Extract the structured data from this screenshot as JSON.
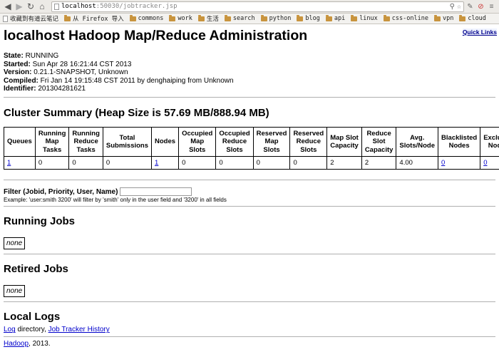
{
  "browser": {
    "url_host": "localhost",
    "url_rest": ":50030/jobtracker.jsp",
    "bookmarks": [
      "收藏到有道云笔记",
      "从 Firefox 导入",
      "commons",
      "work",
      "生活",
      "search",
      "python",
      "blog",
      "api",
      "linux",
      "css-online",
      "vpn",
      "cloud"
    ]
  },
  "page": {
    "quick_links": "Quick Links",
    "title": "localhost Hadoop Map/Reduce Administration",
    "info": {
      "state_label": "State:",
      "state": "RUNNING",
      "started_label": "Started:",
      "started": "Sun Apr 28 16:21:44 CST 2013",
      "version_label": "Version:",
      "version": "0.21.1-SNAPSHOT, Unknown",
      "compiled_label": "Compiled:",
      "compiled": "Fri Jan 14 19:15:48 CST 2011 by denghaiping from Unknown",
      "identifier_label": "Identifier:",
      "identifier": "201304281621"
    },
    "cluster": {
      "title": "Cluster Summary (Heap Size is 57.69 MB/888.94 MB)",
      "headers": [
        "Queues",
        "Running Map Tasks",
        "Running Reduce Tasks",
        "Total Submissions",
        "Nodes",
        "Occupied Map Slots",
        "Occupied Reduce Slots",
        "Reserved Map Slots",
        "Reserved Reduce Slots",
        "Map Slot Capacity",
        "Reduce Slot Capacity",
        "Avg. Slots/Node",
        "Blacklisted Nodes",
        "Excluded Nodes"
      ],
      "values": [
        "1",
        "0",
        "0",
        "0",
        "1",
        "0",
        "0",
        "0",
        "0",
        "2",
        "2",
        "4.00",
        "0",
        "0"
      ]
    },
    "filter": {
      "label": "Filter (Jobid, Priority, User, Name)",
      "value": "",
      "hint": "Example: 'user:smith 3200' will filter by 'smith' only in the user field and '3200' in all fields"
    },
    "running_jobs": {
      "title": "Running Jobs",
      "empty": "none"
    },
    "retired_jobs": {
      "title": "Retired Jobs",
      "empty": "none"
    },
    "local_logs": {
      "title": "Local Logs",
      "log_link": "Log",
      "directory_text": " directory, ",
      "history_link": "Job Tracker History"
    },
    "footer": {
      "link": "Hadoop",
      "text": ", 2013."
    }
  }
}
